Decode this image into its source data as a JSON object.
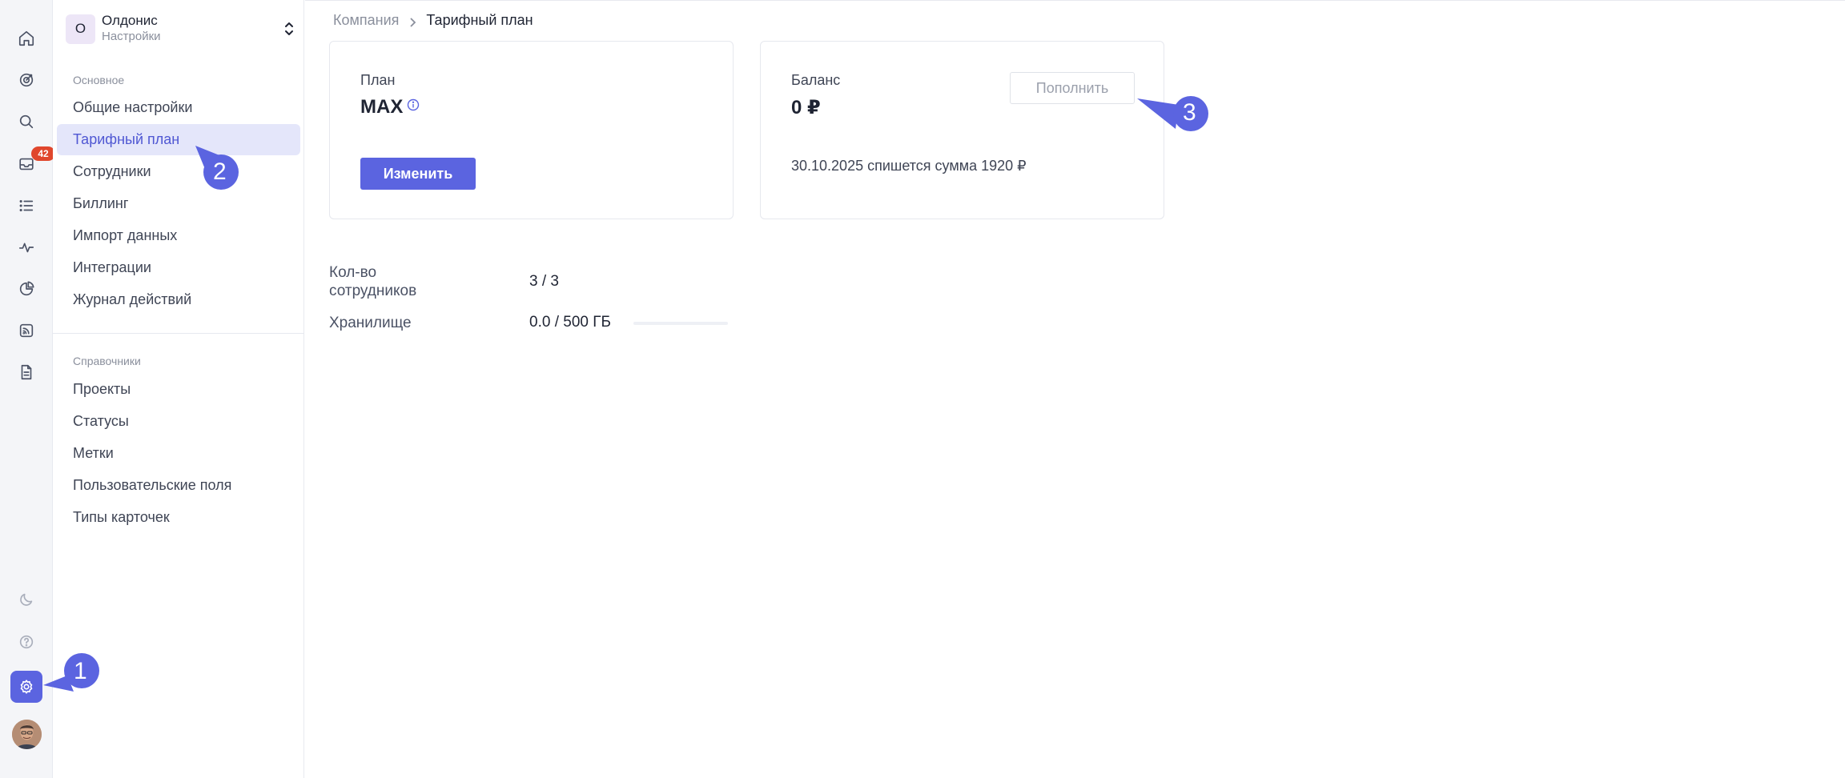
{
  "rail": {
    "items": [
      {
        "name": "home-icon",
        "label": "Главная"
      },
      {
        "name": "target-icon",
        "label": "Цели"
      },
      {
        "name": "search-icon",
        "label": "Поиск"
      },
      {
        "name": "inbox-icon",
        "label": "Входящие",
        "badge": "42"
      },
      {
        "name": "list-icon",
        "label": "Задачи"
      },
      {
        "name": "activity-icon",
        "label": "Активность"
      },
      {
        "name": "pie-chart-icon",
        "label": "Отчёты"
      },
      {
        "name": "feed-icon",
        "label": "Лента"
      },
      {
        "name": "document-icon",
        "label": "Документы"
      }
    ],
    "bottom": [
      {
        "name": "moon-icon",
        "label": "Тема"
      },
      {
        "name": "help-icon",
        "label": "Помощь"
      },
      {
        "name": "gear-icon",
        "label": "Настройки",
        "active": true
      }
    ]
  },
  "sidebar": {
    "org": {
      "initial": "О",
      "name": "Олдонис",
      "subtitle": "Настройки"
    },
    "section_main": "Основное",
    "main_items": [
      {
        "label": "Общие настройки"
      },
      {
        "label": "Тарифный план",
        "active": true
      },
      {
        "label": "Сотрудники"
      },
      {
        "label": "Биллинг"
      },
      {
        "label": "Импорт данных"
      },
      {
        "label": "Интеграции"
      },
      {
        "label": "Журнал действий"
      }
    ],
    "section_refs": "Справочники",
    "ref_items": [
      {
        "label": "Проекты"
      },
      {
        "label": "Статусы"
      },
      {
        "label": "Метки"
      },
      {
        "label": "Пользовательские поля"
      },
      {
        "label": "Типы карточек"
      }
    ]
  },
  "breadcrumb": {
    "parent": "Компания",
    "current": "Тарифный план"
  },
  "plan_card": {
    "label": "План",
    "value": "MAX",
    "button": "Изменить"
  },
  "balance_card": {
    "label": "Баланс",
    "value": "0 ₽",
    "button": "Пополнить",
    "note": "30.10.2025 спишется сумма 1920 ₽"
  },
  "stats": {
    "employees_label": "Кол-во сотрудников",
    "employees_value": "3 / 3",
    "storage_label": "Хранилище",
    "storage_value": "0.0 / 500 ГБ",
    "storage_fraction": 0
  },
  "markers": {
    "one": "1",
    "two": "2",
    "three": "3"
  },
  "colors": {
    "accent": "#5b64e0",
    "badge": "#e0472d",
    "marker": "#5b64e0"
  }
}
